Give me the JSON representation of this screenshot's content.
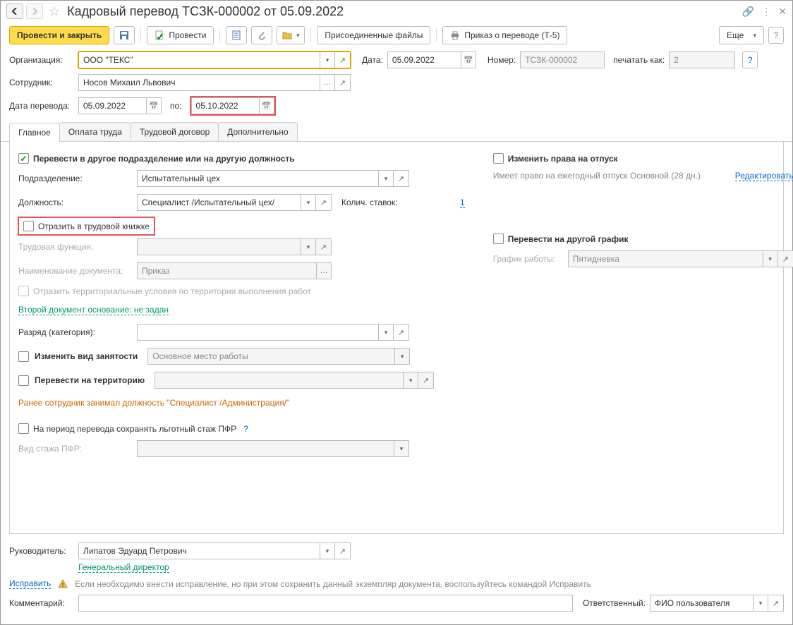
{
  "title": "Кадровый перевод ТСЗК-000002 от 05.09.2022",
  "toolbar": {
    "post_close": "Провести и закрыть",
    "post": "Провести",
    "attached": "Присоединенные файлы",
    "order": "Приказ о переводе (Т-5)",
    "more": "Еще"
  },
  "labels": {
    "org": "Организация:",
    "date": "Дата:",
    "number": "Номер:",
    "print_as": "печатать как:",
    "employee": "Сотрудник:",
    "transfer_date": "Дата перевода:",
    "to": "по:",
    "manager": "Руководитель:",
    "comment": "Комментарий:",
    "responsible": "Ответственный:",
    "fix": "Исправить"
  },
  "values": {
    "org": "ООО \"ТЕКС\"",
    "date": "05.09.2022",
    "number": "ТСЗК-000002",
    "print_as": "2",
    "employee": "Носов Михаил Львович",
    "transfer_date": "05.09.2022",
    "date_to": "05.10.2022",
    "manager": "Липатов Эдуард Петрович",
    "manager_pos": "Генеральный директор",
    "responsible": "ФИО пользователя"
  },
  "tabs": [
    "Главное",
    "Оплата труда",
    "Трудовой договор",
    "Дополнительно"
  ],
  "main": {
    "transfer_check": "Перевести в другое подразделение или на другую должность",
    "subdiv_label": "Подразделение:",
    "subdiv": "Испытательный цех",
    "position_label": "Должность:",
    "position": "Специалист /Испытательный цех/",
    "rate_label": "Колич. ставок:",
    "rate": "1",
    "workbook": "Отразить в трудовой книжке",
    "labor_func_label": "Трудовая функция:",
    "doc_name_label": "Наименование документа:",
    "doc_name": "Приказ",
    "territory_check": "Отразить территориальные условия по территории выполнения работ",
    "second_doc": "Второй документ основание: не задан",
    "rank_label": "Разряд (категория):",
    "change_employment": "Изменить вид занятости",
    "employment_type": "Основное место работы",
    "move_territory": "Перевести на территорию",
    "prev_position": "Ранее сотрудник занимал должность \"Специалист /Администрация/\"",
    "pfr": "На период перевода сохранять льготный стаж ПФР",
    "pfr_type_label": "Вид стажа ПФР:",
    "change_leave": "Изменить права на отпуск",
    "leave_info": "Имеет право на ежегодный отпуск Основной (28 дн.)",
    "edit": "Редактировать",
    "change_schedule": "Перевести на другой график",
    "schedule_label": "График работы:",
    "schedule": "Пятидневка"
  },
  "footer_warn": "Если необходимо внести исправление, но при этом сохранить данный экземпляр документа, воспользуйтесь командой Исправить"
}
